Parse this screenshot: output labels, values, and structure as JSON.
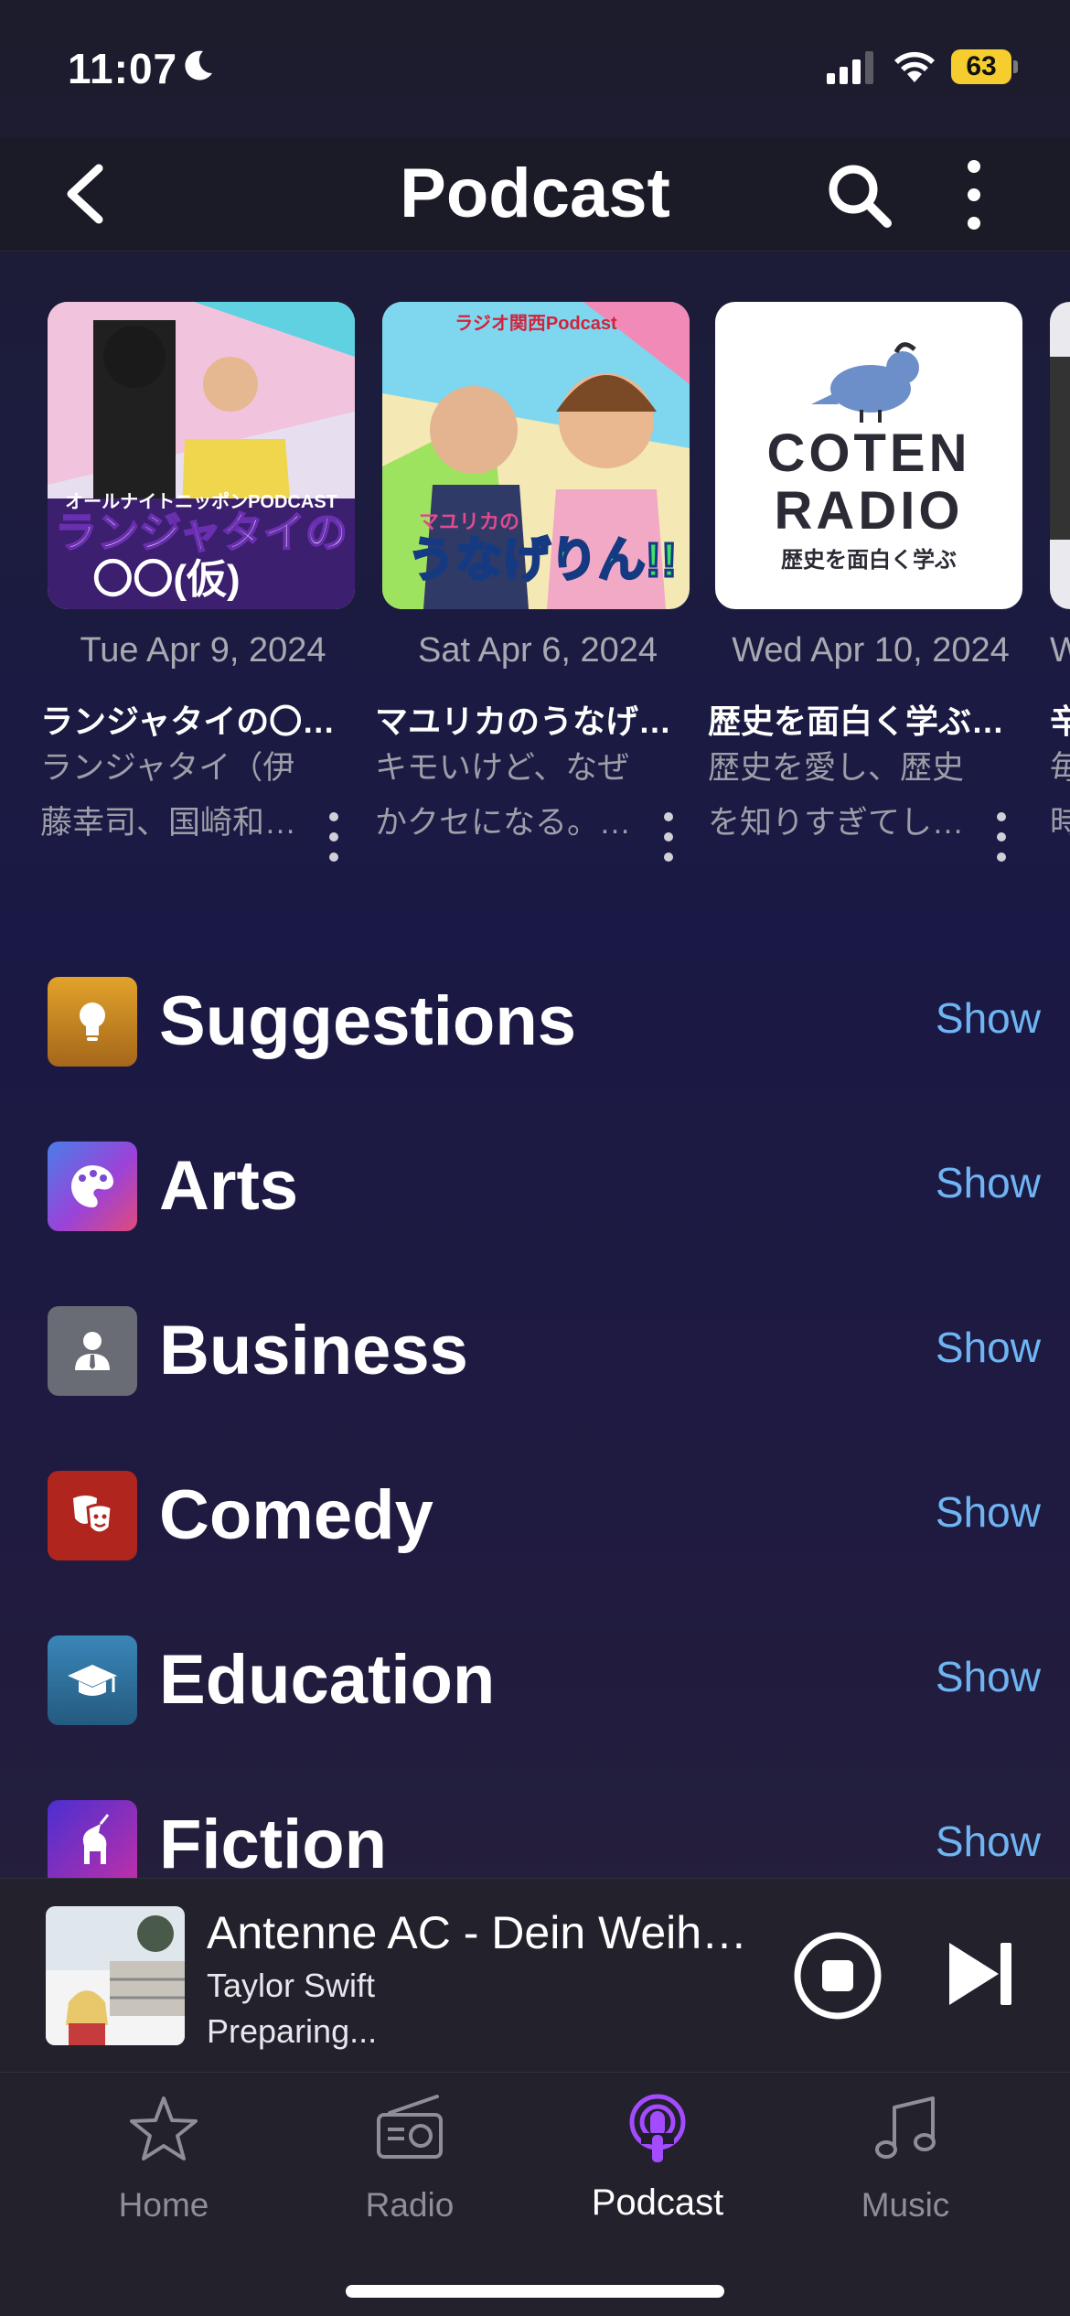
{
  "status_bar": {
    "time": "11:07",
    "battery": "63",
    "icons": [
      "moon-icon",
      "cellular-signal-icon",
      "wifi-icon",
      "battery-icon"
    ]
  },
  "nav": {
    "title": "Podcast",
    "icons": [
      "back-chevron-icon",
      "search-icon",
      "more-vertical-icon"
    ]
  },
  "episodes": [
    {
      "date": "Tue Apr 9, 2024",
      "title": "ランジャタイの〇…",
      "description": "ランジャタイ（伊藤幸司、国崎和…",
      "art_text_top": "オールナイトニッポンPODCAST",
      "art_text_main": "ランジャタイの",
      "art_text_sub": "〇〇(仮)"
    },
    {
      "date": "Sat Apr 6, 2024",
      "title": "マユリカのうなげ…",
      "description": "キモいけど、なぜかクセになる。…",
      "art_text_top": "ラジオ関西Podcast",
      "art_text_small": "マユリカの",
      "art_text_main": "うなげりん!!"
    },
    {
      "date": "Wed Apr 10, 2024",
      "title": "歴史を面白く学ぶ…",
      "description": "歴史を愛し、歴史を知りすぎてし…",
      "art_line1": "COTEN",
      "art_line2": "RADIO",
      "art_line3": "歴史を面白く学ぶ"
    },
    {
      "date": "W",
      "title": "辛",
      "description": "毎時"
    }
  ],
  "categories": [
    {
      "label": "Suggestions",
      "action": "Show",
      "icon": "lightbulb-icon",
      "color": "#d7941f"
    },
    {
      "label": "Arts",
      "action": "Show",
      "icon": "palette-icon",
      "color": "#8a4ad8"
    },
    {
      "label": "Business",
      "action": "Show",
      "icon": "person-tie-icon",
      "color": "#6e7079"
    },
    {
      "label": "Comedy",
      "action": "Show",
      "icon": "theater-masks-icon",
      "color": "#b62a23"
    },
    {
      "label": "Education",
      "action": "Show",
      "icon": "graduation-cap-icon",
      "color": "#2e6d9b"
    },
    {
      "label": "Fiction",
      "action": "Show",
      "icon": "unicorn-icon",
      "color": "#6b2fb8"
    }
  ],
  "player": {
    "title": "Antenne AC - Dein Weih…",
    "artist": "Taylor Swift",
    "status": "Preparing..."
  },
  "tabs": [
    {
      "label": "Home",
      "icon": "star-icon",
      "active": false
    },
    {
      "label": "Radio",
      "icon": "radio-icon",
      "active": false
    },
    {
      "label": "Podcast",
      "icon": "podcast-icon",
      "active": true
    },
    {
      "label": "Music",
      "icon": "music-note-icon",
      "active": false
    }
  ],
  "colors": {
    "accent": "#a34bff",
    "link": "#6fb5f3",
    "battery": "#f5cd2f"
  }
}
